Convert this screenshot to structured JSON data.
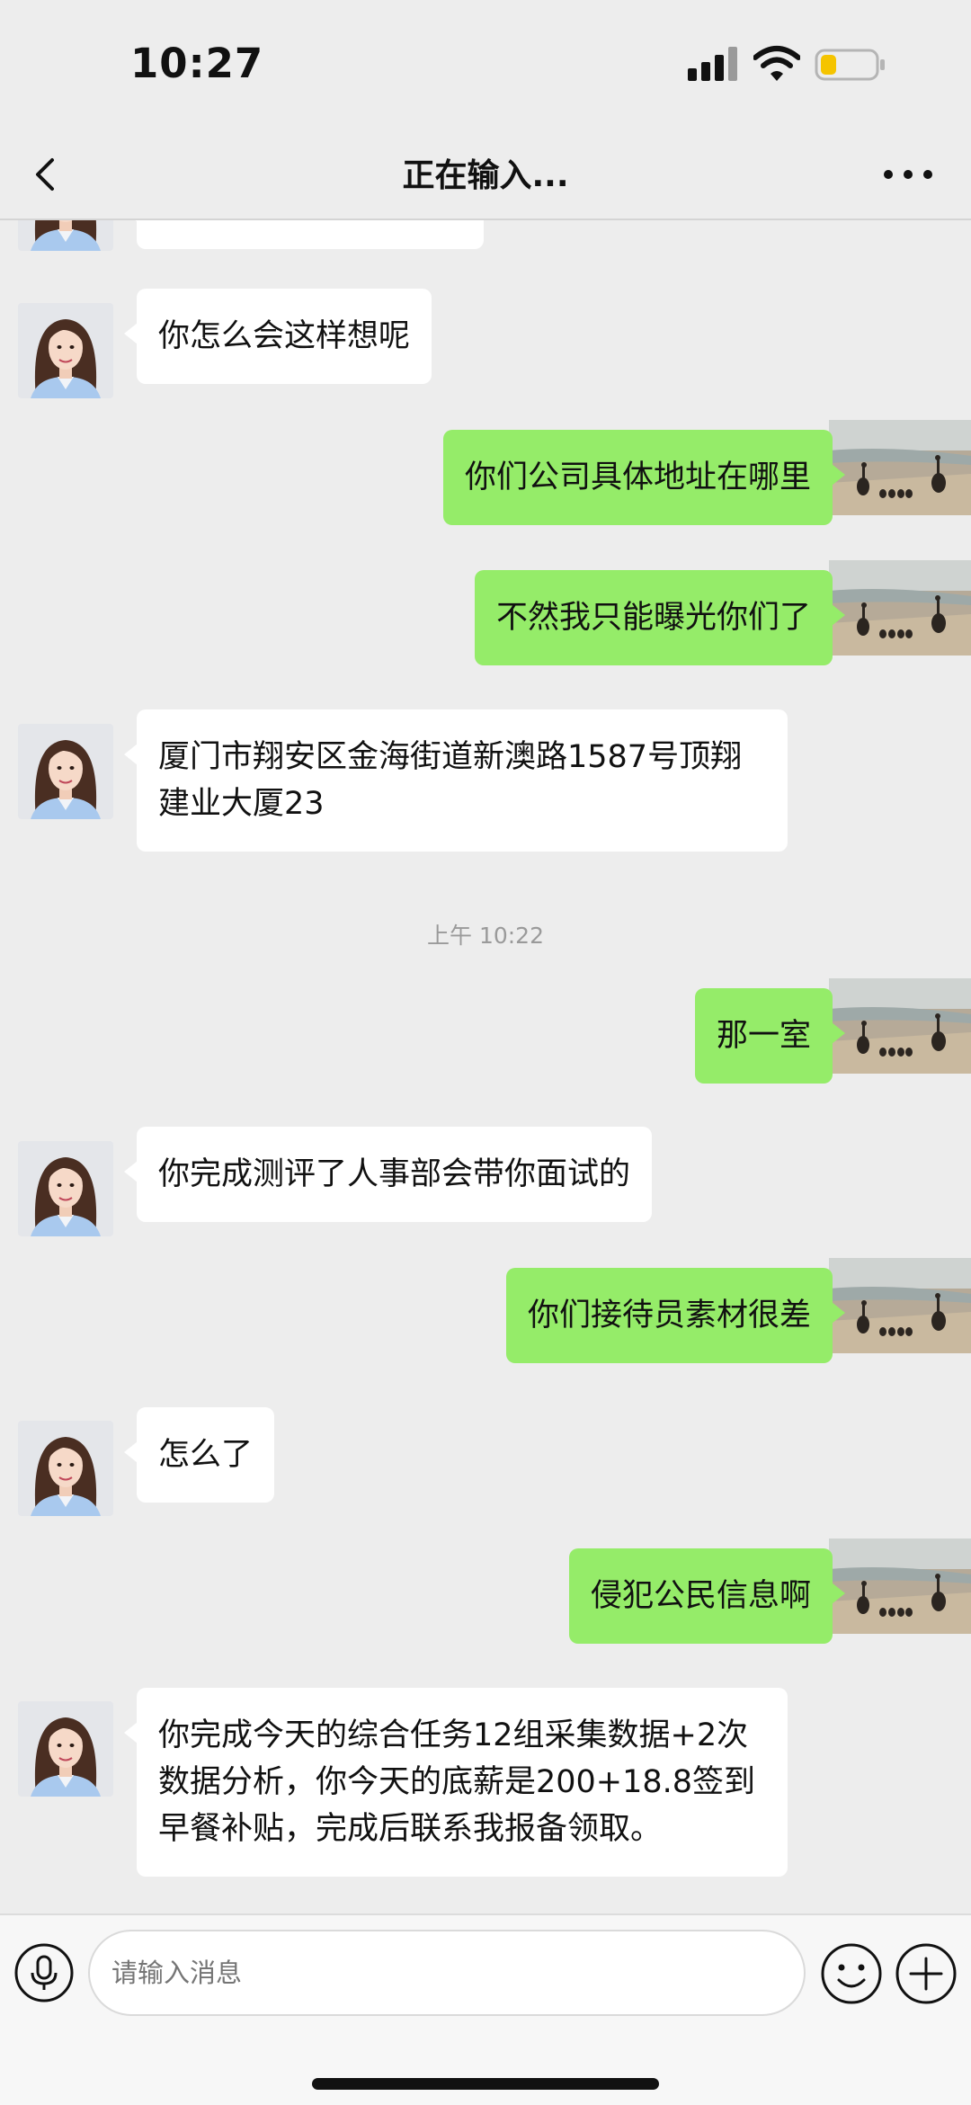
{
  "status_bar": {
    "time": "10:27",
    "battery_color": "#f5c400"
  },
  "nav": {
    "title": "正在输入..."
  },
  "messages": [
    {
      "side": "in",
      "text": "你怎么会这样想呢"
    },
    {
      "side": "out",
      "text": "你们公司具体地址在哪里"
    },
    {
      "side": "out",
      "text": "不然我只能曝光你们了"
    },
    {
      "side": "in",
      "text": "厦门市翔安区金海街道新澳路1587号顶翔建业大厦23"
    },
    {
      "side": "out",
      "text": "那一室"
    },
    {
      "side": "in",
      "text": "你完成测评了人事部会带你面试的"
    },
    {
      "side": "out",
      "text": "你们接待员素材很差"
    },
    {
      "side": "in",
      "text": "怎么了"
    },
    {
      "side": "out",
      "text": "侵犯公民信息啊"
    },
    {
      "side": "in",
      "text": "你完成今天的综合任务12组采集数据+2次数据分析，你今天的底薪是200+18.8签到早餐补贴，完成后联系我报备领取。"
    }
  ],
  "timestamp": "上午 10:22",
  "input_bar": {
    "placeholder": "请输入消息"
  },
  "colors": {
    "outgoing_bubble": "#95ec69",
    "incoming_bubble": "#ffffff",
    "background": "#ededed"
  },
  "icons": [
    "back-icon",
    "more-icon",
    "mic-icon",
    "emoji-icon",
    "plus-icon",
    "signal-icon",
    "wifi-icon",
    "battery-icon"
  ]
}
